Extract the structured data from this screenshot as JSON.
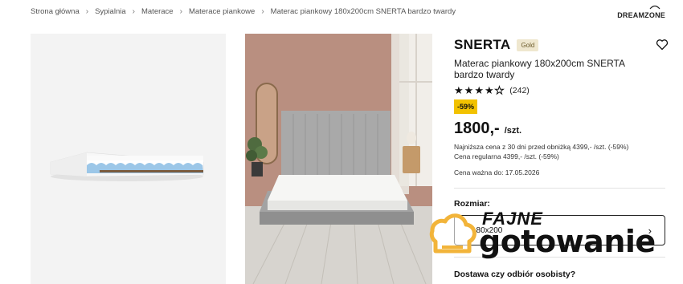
{
  "breadcrumb": [
    "Strona główna",
    "Sypialnia",
    "Materace",
    "Materace piankowe",
    "Materac piankowy 180x200cm SNERTA bardzo twardy"
  ],
  "brand_logo": "DREAMZONE",
  "product": {
    "brand": "SNERTA",
    "badge": "Gold",
    "title": "Materac piankowy 180x200cm SNERTA bardzo twardy",
    "rating_stars": 4,
    "rating_max": 5,
    "review_count": "(242)",
    "discount": "-59%",
    "price": "1800,-",
    "unit": "/szt.",
    "lowest_price_note": "Najniższa cena z 30 dni przed obniżką 4399,- /szt. (-59%)",
    "regular_price_note": "Cena regularna 4399,- /szt. (-59%)",
    "valid_until": "Cena ważna do: 17.05.2026"
  },
  "size": {
    "label": "Rozmiar:",
    "value": "180x200"
  },
  "delivery": {
    "label": "Dostawa czy odbiór osobisty?"
  },
  "watermark": {
    "line1": "FAJNE",
    "line2": "gotowanie"
  },
  "icons": [
    "chevron-right-icon",
    "heart-icon",
    "star-icon",
    "chevron-right-icon",
    "chef-hat-icon"
  ],
  "colors": {
    "badge_gold_bg": "#efe7cf",
    "discount_bg": "#f2c200",
    "wall": "#b98f80",
    "watermark_accent": "#f2b43a"
  }
}
